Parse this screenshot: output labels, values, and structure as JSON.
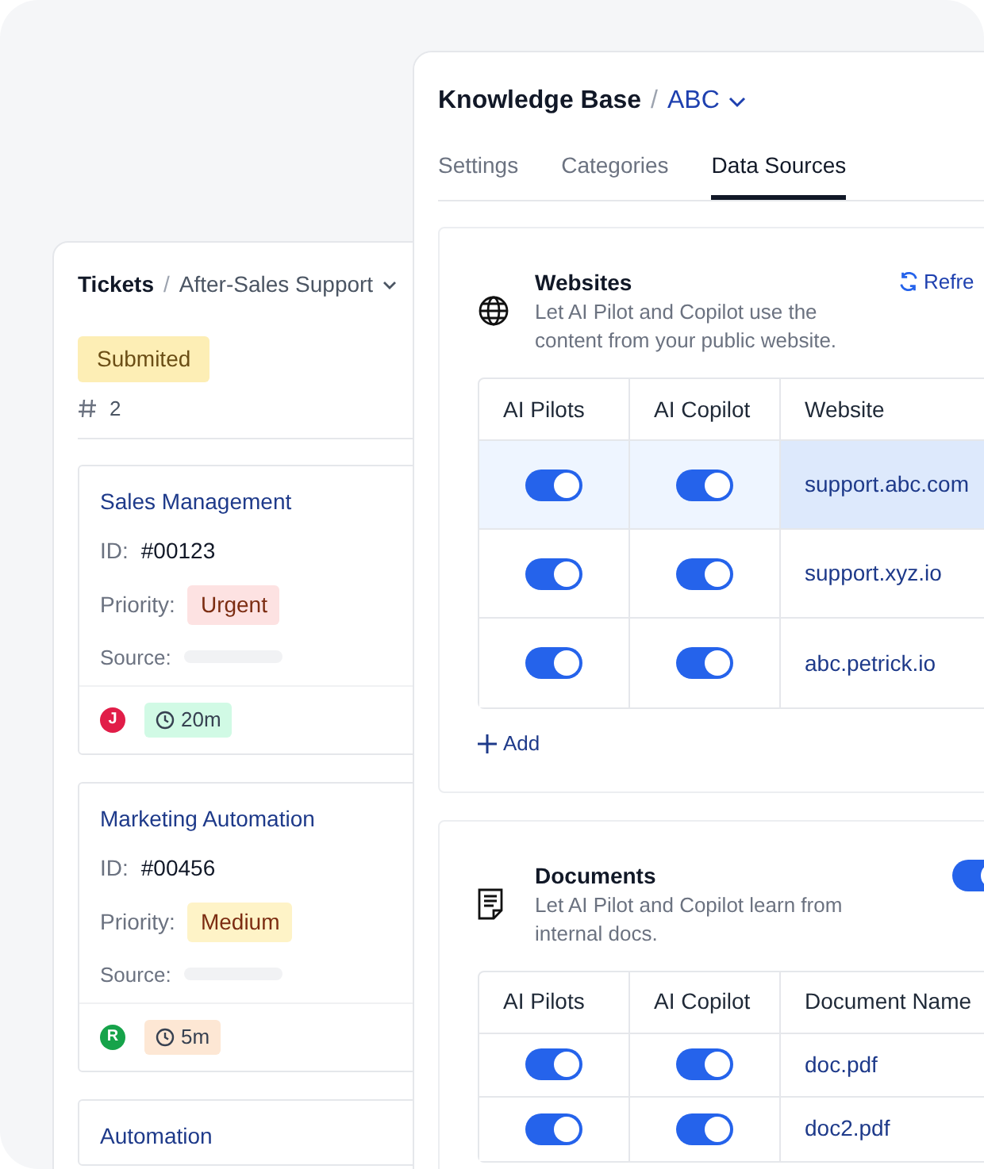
{
  "tickets_panel": {
    "title": "Tickets",
    "separator": "/",
    "breadcrumb": "After-Sales Support",
    "status": "Submited",
    "count": "2",
    "cards": [
      {
        "title": "Sales Management",
        "id_label": "ID:",
        "id": "#00123",
        "priority_label": "Priority:",
        "priority": {
          "label": "Urgent",
          "color": "#fde2e2"
        },
        "source_label": "Source:",
        "avatar": {
          "letter": "J",
          "color": "#e11d48"
        },
        "time": {
          "label": "20m",
          "color": "#d1fae5"
        }
      },
      {
        "title": "Marketing Automation",
        "id_label": "ID:",
        "id": "#00456",
        "priority_label": "Priority:",
        "priority": {
          "label": "Medium",
          "color": "#fef3c7"
        },
        "source_label": "Source:",
        "avatar": {
          "letter": "R",
          "color": "#16a34a"
        },
        "time": {
          "label": "5m",
          "color": "#fde7d4"
        }
      },
      {
        "title": "Automation"
      }
    ]
  },
  "kb_panel": {
    "title": "Knowledge Base",
    "separator": "/",
    "breadcrumb": "ABC",
    "tabs": [
      {
        "label": "Settings",
        "selected": false
      },
      {
        "label": "Categories",
        "selected": false
      },
      {
        "label": "Data Sources",
        "selected": true
      }
    ],
    "sections": [
      {
        "kind": "websites",
        "title": "Websites",
        "description": "Let AI Pilot and Copilot use the content from your public website.",
        "action": "Refre",
        "columns": [
          "AI Pilots",
          "AI Copilot",
          "Website"
        ],
        "rows": [
          {
            "pilot_on": true,
            "copilot_on": true,
            "value": "support.abc.com",
            "selected": true
          },
          {
            "pilot_on": true,
            "copilot_on": true,
            "value": "support.xyz.io",
            "selected": false
          },
          {
            "pilot_on": true,
            "copilot_on": true,
            "value": "abc.petrick.io",
            "selected": false
          }
        ],
        "add": "Add"
      },
      {
        "kind": "documents",
        "title": "Documents",
        "description": "Let AI Pilot and Copilot learn from internal docs.",
        "on": true,
        "columns": [
          "AI Pilots",
          "AI Copilot",
          "Document Name"
        ],
        "rows": [
          {
            "pilot_on": true,
            "copilot_on": true,
            "value": "doc.pdf",
            "selected": false
          },
          {
            "pilot_on": true,
            "copilot_on": true,
            "value": "doc2.pdf",
            "selected": false
          }
        ]
      }
    ]
  }
}
